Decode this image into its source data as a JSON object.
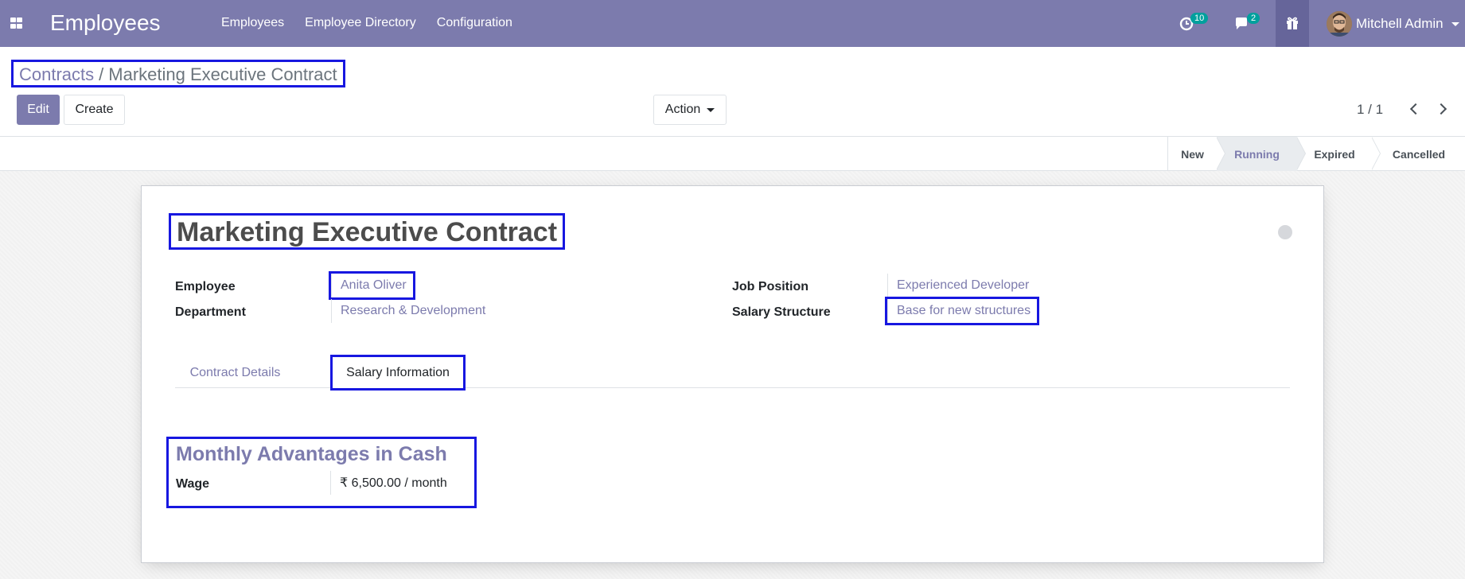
{
  "navbar": {
    "app_title": "Employees",
    "menu": [
      "Employees",
      "Employee Directory",
      "Configuration"
    ],
    "activity_count": "10",
    "message_count": "2",
    "user_name": "Mitchell Admin",
    "bg_color": "#7c7bad"
  },
  "breadcrumb": {
    "parent": "Contracts",
    "separator": "/",
    "current": "Marketing Executive Contract"
  },
  "toolbar": {
    "edit_label": "Edit",
    "create_label": "Create",
    "action_label": "Action"
  },
  "pager": {
    "value": "1 / 1"
  },
  "statusbar": {
    "stages": [
      "New",
      "Running",
      "Expired",
      "Cancelled"
    ],
    "current": "Running"
  },
  "record": {
    "title": "Marketing Executive Contract",
    "employee_label": "Employee",
    "employee_value": "Anita Oliver",
    "department_label": "Department",
    "department_value": "Research & Development",
    "job_label": "Job Position",
    "job_value": "Experienced Developer",
    "structure_label": "Salary Structure",
    "structure_value": "Base for new structures"
  },
  "tabs": {
    "details": "Contract Details",
    "salary": "Salary Information",
    "active": "Salary Information"
  },
  "salary": {
    "group_title": "Monthly Advantages in Cash",
    "wage_label": "Wage",
    "wage_value": "₹ 6,500.00 / month"
  },
  "icons": {
    "apps": "apps-grid-icon",
    "activity": "clock-icon",
    "messages": "chat-icon",
    "gift": "gift-icon",
    "pager_prev": "chevron-left-icon",
    "pager_next": "chevron-right-icon"
  }
}
